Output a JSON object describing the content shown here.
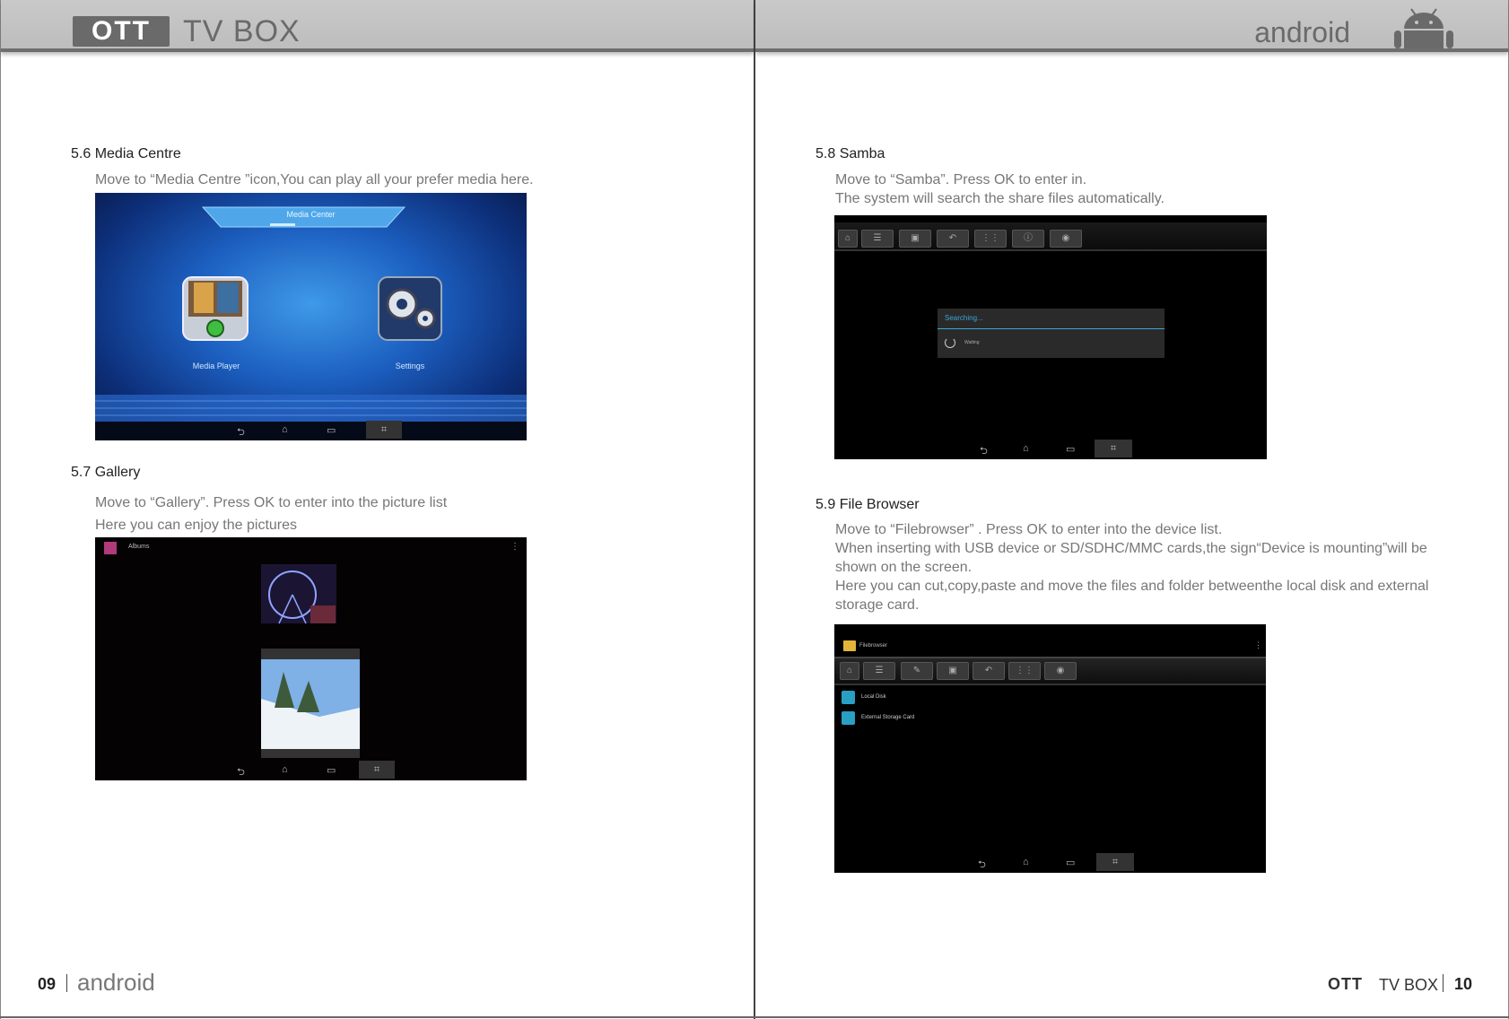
{
  "header": {
    "logo_badge": "OTT",
    "logo_text": "TV BOX",
    "right_label": "android"
  },
  "left_page": {
    "sections": [
      {
        "title": "5.6 Media Centre",
        "lines": [
          "Move to “Media Centre ”icon,You can play all your prefer media here."
        ],
        "screenshot": {
          "banner": "Media Center",
          "items": [
            "Media Player",
            "Settings"
          ]
        }
      },
      {
        "title": "5.7 Gallery",
        "lines": [
          "Move to “Gallery”. Press OK to enter into the picture list",
          "Here you can enjoy the pictures"
        ],
        "screenshot": {
          "album_title": "Albums"
        }
      }
    ],
    "footer": {
      "page_number": "09",
      "brand": "android"
    }
  },
  "right_page": {
    "sections": [
      {
        "title": "5.8 Samba",
        "lines": [
          "Move to “Samba”. Press OK to enter in.",
          "The system will search the share files automatically."
        ],
        "screenshot": {
          "dialog_title": "Searching...",
          "dialog_status": "Waiting"
        }
      },
      {
        "title": "5.9 File Browser",
        "lines": [
          "Move to “Filebrowser” . Press OK to enter into the device list.",
          "When inserting with USB device or SD/SDHC/MMC cards,the sign“Device is mounting”will be",
          "shown on the screen.",
          "Here you can cut,copy,paste and move the files and folder betweenthe local disk and external",
          "storage card."
        ],
        "screenshot": {
          "app_title": "Filebrowser",
          "devices": [
            "Local Disk",
            "External Storage Card"
          ]
        }
      }
    ],
    "footer": {
      "badge": "OTT",
      "brand": "TV BOX",
      "page_number": "10"
    }
  },
  "colors": {
    "header_bg": "#c4c4c4",
    "header_text": "#6a6a6a",
    "body_text": "#777777",
    "title_text": "#222222",
    "media_blue": "#1c4fa8"
  },
  "icons": [
    "android-robot-icon",
    "back-icon",
    "home-icon",
    "recents-icon",
    "screenshot-icon",
    "gear-icon",
    "folder-icon",
    "spinner-icon"
  ]
}
